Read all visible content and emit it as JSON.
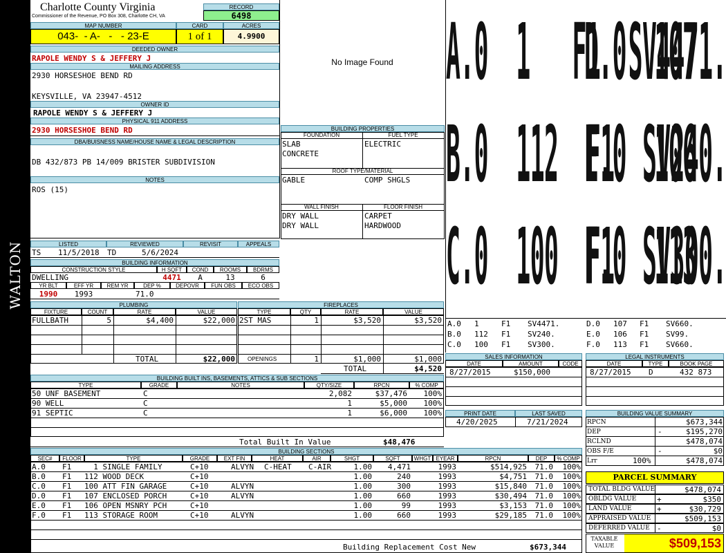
{
  "side_label": "WALTON",
  "county": {
    "title": "Charlotte County Virginia",
    "subtitle": "Commissioner of the Revenue, PO Box 308, Charlotte CH, VA"
  },
  "record": {
    "label": "RECORD",
    "value": "6498"
  },
  "map": {
    "map_label": "MAP NUMBER",
    "map_value": "043-  - A-   -   - 23-E",
    "card_label": "CARD",
    "card_value": "1 of 1",
    "acres_label": "ACRES",
    "acres_value": "4.9900"
  },
  "deeded": {
    "label": "DEEDED OWNER",
    "value": "RAPOLE WENDY S & JEFFERY J"
  },
  "mailing": {
    "label": "MAILING ADDRESS",
    "line1": "2930 HORSESHOE BEND RD",
    "line2": "KEYSVILLE, VA 23947-4512"
  },
  "owner_id": {
    "label": "OWNER ID",
    "value": "RAPOLE WENDY S & JEFFERY J"
  },
  "physical": {
    "label": "PHYSICAL 911 ADDRESS",
    "value": "2930 HORSESHOE BEND RD"
  },
  "dba": {
    "label": "DBA/BUISNESS NAME/HOUSE NAME & LEGAL DESCRIPTION",
    "value": "DB 432/873 PB 14/009 BRISTER SUBDIVISION"
  },
  "notes": {
    "label": "NOTES",
    "value": "ROS (15)"
  },
  "photo": {
    "text": "No Image Found"
  },
  "building_props": {
    "label": "BUILDING PROPERTIES",
    "foundation_label": "FOUNDATION",
    "fuel_label": "FUEL TYPE",
    "foundation": [
      "SLAB",
      "CONCRETE"
    ],
    "fuel": [
      "ELECTRIC"
    ],
    "roof_label": "ROOF TYPE/MATERIAL",
    "roof_type": "GABLE",
    "roof_material": "COMP SHGLS",
    "wall_label": "WALL FINISH",
    "floor_label": "FLOOR FINISH",
    "wall": [
      "DRY WALL",
      "DRY WALL"
    ],
    "floor": [
      "CARPET",
      "HARDWOOD"
    ]
  },
  "sketch": {
    "rows": [
      [
        "A.0  1   F1  SV4471.",
        "D.0  107  F1  SV660."
      ],
      [
        "B.0  112  F1  SV240.",
        "E.0  106  F1  SV99."
      ],
      [
        "C.0  100  F1  SV300.",
        "F.0  113  F1  SV660."
      ]
    ]
  },
  "sketch_legend": [
    [
      "A.0",
      "1",
      "F1",
      "SV4471.",
      "D.0",
      "107",
      "F1",
      "SV660."
    ],
    [
      "B.0",
      "112",
      "F1",
      "SV240.",
      "E.0",
      "106",
      "F1",
      "SV99."
    ],
    [
      "C.0",
      "100",
      "F1",
      "SV300.",
      "F.0",
      "113",
      "F1",
      "SV660."
    ]
  ],
  "listed": {
    "listed_label": "LISTED",
    "reviewed_label": "REVIEWED",
    "revisit_label": "REVISIT",
    "appeals_label": "APPEALS",
    "listed_by": "TS",
    "listed_date": "11/5/2018",
    "reviewed_by": "TD",
    "reviewed_date": "5/6/2024"
  },
  "building_info": {
    "label": "BUILDING INFORMATION",
    "h_construction": "CONSTRUCTION STYLE",
    "h_hsqft": "H SQFT",
    "h_cond": "COND",
    "h_rooms": "ROOMS",
    "h_bdrms": "BDRMS",
    "construction": "DWELLING",
    "hsqft": "4471",
    "cond": "A",
    "rooms": "13",
    "bdrms": "6",
    "h_yrblt": "YR BLT",
    "h_effyr": "EFF YR",
    "h_remyr": "REM YR",
    "h_dep": "DEP %",
    "h_depovr": "DEPOVR",
    "h_funobs": "FUN OBS",
    "h_ecoobs": "ECO OBS",
    "yrblt": "1990",
    "effyr": "1993",
    "dep": "71.0"
  },
  "plumbing": {
    "label": "PLUMBING",
    "h_fixture": "FIXTURE",
    "h_count": "COUNT",
    "h_rate": "RATE",
    "h_value": "VALUE",
    "rows": [
      {
        "fixture": "FULLBATH",
        "count": "5",
        "rate": "$4,400",
        "value": "$22,000"
      }
    ],
    "total_label": "TOTAL",
    "total": "$22,000"
  },
  "fireplaces": {
    "label": "FIREPLACES",
    "h_type": "TYPE",
    "h_qty": "QTY",
    "h_rate": "RATE",
    "h_value": "VALUE",
    "rows": [
      {
        "type": "2ST MAS",
        "qty": "1",
        "rate": "$3,520",
        "value": "$3,520"
      }
    ],
    "openings_label": "OPENINGS",
    "openings_qty": "1",
    "openings_rate": "$1,000",
    "openings_value": "$1,000",
    "total_label": "TOTAL",
    "total": "$4,520"
  },
  "sales": {
    "label": "SALES INFORMATION",
    "h_date": "DATE",
    "h_amount": "AMOUNT",
    "h_code": "CODE",
    "date": "8/27/2015",
    "amount": "$150,000"
  },
  "legal": {
    "label": "LEGAL INSTRUMENTS",
    "h_date": "DATE",
    "h_type": "TYPE",
    "h_book": "BOOK PAGE",
    "date": "8/27/2015",
    "type": "D",
    "book": "432 873"
  },
  "builtins": {
    "label": "BUILDING BUILT INS, BASEMENTS, ATTICS & SUB SECTIONS",
    "h_type": "TYPE",
    "h_grade": "GRADE",
    "h_notes": "NOTES",
    "h_qty": "QTY/SIZE",
    "h_rpcn": "RPCN",
    "h_comp": "% COMP",
    "rows": [
      {
        "type": "50 UNF BASEMENT",
        "grade": "C",
        "qty": "2,082",
        "rpcn": "$37,476",
        "comp": "100%"
      },
      {
        "type": "90 WELL",
        "grade": "C",
        "qty": "1",
        "rpcn": "$5,000",
        "comp": "100%"
      },
      {
        "type": "91 SEPTIC",
        "grade": "C",
        "qty": "1",
        "rpcn": "$6,000",
        "comp": "100%"
      }
    ],
    "total_label": "Total Built In Value",
    "total": "$48,476"
  },
  "print": {
    "print_label": "PRINT DATE",
    "saved_label": "LAST SAVED",
    "print_date": "4/20/2025",
    "saved_date": "7/21/2024"
  },
  "value_summary": {
    "label": "BUILDING VALUE SUMMARY",
    "rows": [
      {
        "label": "RPCN",
        "sign": "",
        "value": "$673,344"
      },
      {
        "label": "DEP",
        "sign": "-",
        "value": "$195,270"
      },
      {
        "label": "RCLND",
        "sign": "",
        "value": "$478,074"
      },
      {
        "label": "OBS F/E",
        "sign": "-",
        "value": "$0"
      },
      {
        "label": "Lrr",
        "pct": "100%",
        "sign": "",
        "value": "$478,074"
      }
    ]
  },
  "sections": {
    "label": "BUILDING SECTIONS",
    "h_sec": "SEC#",
    "h_floor": "FLOOR",
    "h_type": "TYPE",
    "h_grade": "GRADE",
    "h_extfin": "EXT FIN",
    "h_heat": "HEAT",
    "h_air": "AIR",
    "h_shgt": "SHGT",
    "h_sqft": "SQFT",
    "h_whgt": "WHGT",
    "h_eyear": "EYEAR",
    "h_rpcn": "RPCN",
    "h_dep": "DEP",
    "h_comp": "% COMP",
    "rows": [
      {
        "sec": "A.0",
        "floor": "F1",
        "type": "  1 SINGLE FAMILY",
        "grade": "C+10",
        "extfin": "ALVYN",
        "heat": "C-HEAT",
        "air": "C-AIR",
        "shgt": "1.00",
        "sqft": "4,471",
        "eyear": "1993",
        "rpcn": "$514,925",
        "dep": "71.0",
        "comp": "100%"
      },
      {
        "sec": "B.0",
        "floor": "F1",
        "type": "112 WOOD DECK",
        "grade": "C+10",
        "extfin": "",
        "heat": "",
        "air": "",
        "shgt": "1.00",
        "sqft": "240",
        "eyear": "1993",
        "rpcn": "$4,751",
        "dep": "71.0",
        "comp": "100%"
      },
      {
        "sec": "C.0",
        "floor": "F1",
        "type": "100 ATT FIN GARAGE",
        "grade": "C+10",
        "extfin": "ALVYN",
        "heat": "",
        "air": "",
        "shgt": "1.00",
        "sqft": "300",
        "eyear": "1993",
        "rpcn": "$15,840",
        "dep": "71.0",
        "comp": "100%"
      },
      {
        "sec": "D.0",
        "floor": "F1",
        "type": "107 ENCLOSED PORCH",
        "grade": "C+10",
        "extfin": "ALVYN",
        "heat": "",
        "air": "",
        "shgt": "1.00",
        "sqft": "660",
        "eyear": "1993",
        "rpcn": "$30,494",
        "dep": "71.0",
        "comp": "100%"
      },
      {
        "sec": "E.0",
        "floor": "F1",
        "type": "106 OPEN MSNRY PCH",
        "grade": "C+10",
        "extfin": "",
        "heat": "",
        "air": "",
        "shgt": "1.00",
        "sqft": "99",
        "eyear": "1993",
        "rpcn": "$3,153",
        "dep": "71.0",
        "comp": "100%"
      },
      {
        "sec": "F.0",
        "floor": "F1",
        "type": "113 STORAGE ROOM",
        "grade": "C+10",
        "extfin": "ALVYN",
        "heat": "",
        "air": "",
        "shgt": "1.00",
        "sqft": "660",
        "eyear": "1993",
        "rpcn": "$29,185",
        "dep": "71.0",
        "comp": "100%"
      }
    ],
    "brcn_label": "Building Replacement Cost New",
    "brcn": "$673,344"
  },
  "parcel": {
    "title": "PARCEL SUMMARY",
    "rows": [
      {
        "label": "TOTAL BLDG VALUE",
        "sign": "",
        "value": "$478,074"
      },
      {
        "label": "OBLDG VALUE",
        "sign": "+",
        "value": "$350"
      },
      {
        "label": "LAND VALUE",
        "sign": "+",
        "value": "$30,729"
      },
      {
        "label": "APPRAISED VALUE",
        "sign": "",
        "value": "$509,153"
      },
      {
        "label": "DEFERRED VALUE",
        "sign": "-",
        "value": "$0"
      }
    ],
    "taxable_label_1": "TAXABLE",
    "taxable_label_2": "VALUE",
    "taxable": "$509,153"
  },
  "colors": {
    "header": "#b7dde8",
    "highlight": "#ffff00",
    "record": "#8ef08e",
    "red": "#c00000"
  }
}
